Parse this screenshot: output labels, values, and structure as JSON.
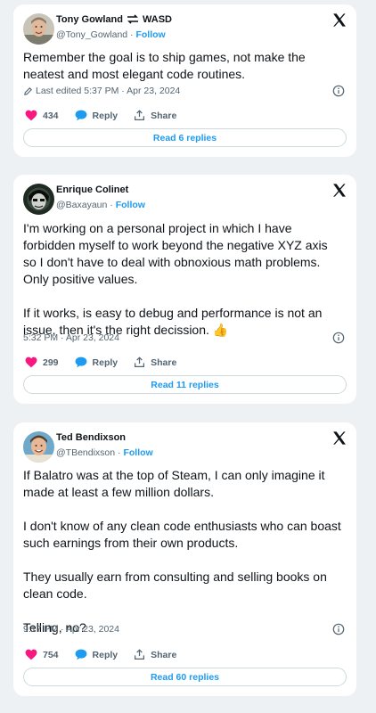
{
  "tweets": [
    {
      "author_name": "Tony Gowland",
      "name_suffix": "WASD",
      "handle": "@Tony_Gowland",
      "follow_label": "Follow",
      "text": [
        "Remember the goal is to ship games, not make the neatest and most elegant code routines."
      ],
      "meta": "Last edited 5:37 PM · Apr 23, 2024",
      "likes": "434",
      "reply_label": "Reply",
      "share_label": "Share",
      "read_replies": "Read 6 replies"
    },
    {
      "author_name": "Enrique Colinet",
      "handle": "@Baxayaun",
      "follow_label": "Follow",
      "text": [
        "I'm working on a personal project in which I have forbidden myself to work beyond the negative XYZ axis so I don't have to deal with obnoxious math problems. Only positive values.",
        "If it works, is easy to debug and performance is not an issue, then it's the right decission."
      ],
      "emoji": "👍",
      "meta": "5:32 PM · Apr 23, 2024",
      "likes": "299",
      "reply_label": "Reply",
      "share_label": "Share",
      "read_replies": "Read 11 replies"
    },
    {
      "author_name": "Ted Bendixson",
      "handle": "@TBendixson",
      "follow_label": "Follow",
      "text": [
        "If Balatro was at the top of Steam, I can only imagine it made at least a few million dollars.",
        "I don't know of any clean code enthusiasts who can boast such earnings from their own products.",
        "They usually earn from consulting and selling books on clean code.",
        "Telling, no?"
      ],
      "meta": "9:17 PM · Apr 23, 2024",
      "likes": "754",
      "reply_label": "Reply",
      "share_label": "Share",
      "read_replies": "Read 60 replies"
    }
  ],
  "colors": {
    "accent": "#1d9bf0",
    "like": "#f91880",
    "muted": "#536471",
    "background": "#eef1f4"
  }
}
